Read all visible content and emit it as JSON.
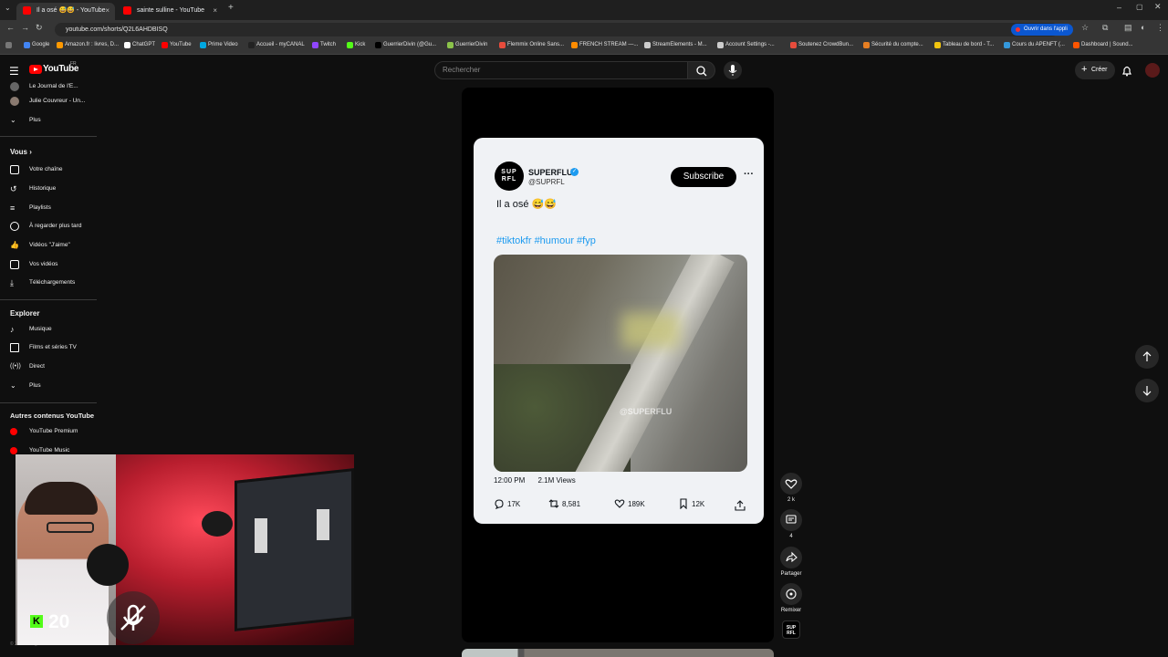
{
  "browser": {
    "tabs": [
      {
        "title": "Il a osé 😅😅 - YouTube",
        "active": true
      },
      {
        "title": "sainte sulline - YouTube",
        "active": false
      }
    ],
    "new_tab": "+",
    "url": "youtube.com/shorts/Q2L6AHDBISQ",
    "open_app_label": "Ouvrir dans l'appli",
    "bookmarks": [
      "Google",
      "Amazon.fr : livres, D...",
      "ChatGPT",
      "YouTube",
      "Prime Video",
      "Accueil - myCANAL",
      "Twitch",
      "Kick",
      "GuerrierDivin (@Gu...",
      "GuerrierDivin",
      "Flemmix Online Sans...",
      "FRENCH STREAM —...",
      "StreamElements - M...",
      "Account Settings -...",
      "Soutenez CrowdBun...",
      "Sécurité du compte...",
      "Tableau de bord - T...",
      "Cours du APENFT (...",
      "Dashboard | Sound..."
    ]
  },
  "youtube": {
    "logo_text": "YouTube",
    "logo_country": "FR",
    "search_placeholder": "Rechercher",
    "create_label": "Créer"
  },
  "sidebar": {
    "top_items": [
      {
        "label": "Le Journal de l'E...",
        "icon": "avatar-icon"
      },
      {
        "label": "Julie Couvreur - Un...",
        "icon": "avatar-icon"
      },
      {
        "label": "Plus",
        "icon": "chevron-down-icon"
      }
    ],
    "you_heading": "Vous",
    "you_items": [
      {
        "label": "Votre chaîne",
        "icon": "channel-icon"
      },
      {
        "label": "Historique",
        "icon": "history-icon"
      },
      {
        "label": "Playlists",
        "icon": "playlist-icon"
      },
      {
        "label": "À regarder plus tard",
        "icon": "clock-icon"
      },
      {
        "label": "Vidéos \"J'aime\"",
        "icon": "thumb-up-icon"
      },
      {
        "label": "Vos vidéos",
        "icon": "video-icon"
      },
      {
        "label": "Téléchargements",
        "icon": "download-icon"
      }
    ],
    "explore_heading": "Explorer",
    "explore_items": [
      {
        "label": "Musique",
        "icon": "music-icon"
      },
      {
        "label": "Films et séries TV",
        "icon": "film-icon"
      },
      {
        "label": "Direct",
        "icon": "live-icon"
      },
      {
        "label": "Plus",
        "icon": "chevron-down-icon"
      }
    ],
    "more_heading": "Autres contenus YouTube",
    "more_items": [
      {
        "label": "YouTube Premium",
        "icon": "youtube-premium-icon"
      },
      {
        "label": "YouTube Music",
        "icon": "youtube-music-icon"
      }
    ],
    "footer": "© 2025 Google LLC"
  },
  "short": {
    "card": {
      "avatar_text": "SUP RFL",
      "name": "SUPERFLU",
      "handle": "@SUPRFL",
      "subscribe_label": "Subscribe",
      "text": "Il a osé 😅😅",
      "hashtags": "#tiktokfr #humour #fyp",
      "watermark": "@SUPERFLU",
      "time": "12:00 PM",
      "views": "2.1M Views",
      "stats": {
        "replies": "17K",
        "retweets": "8,581",
        "likes": "189K",
        "bookmarks": "12K"
      }
    },
    "actions": {
      "like_count": "2 k",
      "comment_count": "4",
      "share_label": "Partager",
      "remix_label": "Remixer"
    }
  },
  "overlay": {
    "kick_viewers": "20",
    "kick_letter": "K"
  },
  "colors": {
    "background": "#0f0f0f",
    "youtube_red": "#ff0000",
    "hashtag_blue": "#1d9bf0",
    "kick_green": "#53fc18"
  }
}
